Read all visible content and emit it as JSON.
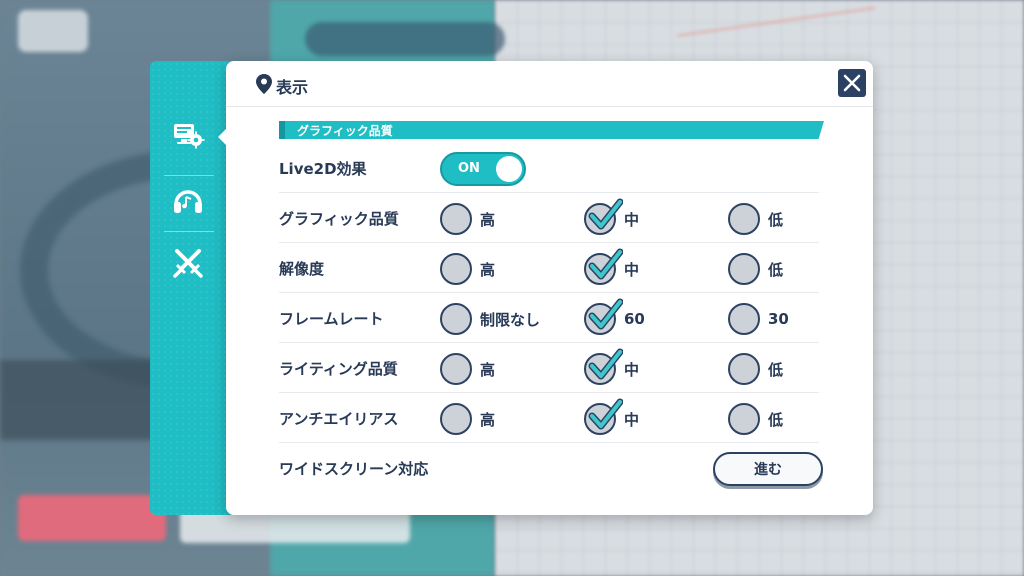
{
  "header": {
    "title": "表示"
  },
  "sidebar": {
    "items": [
      {
        "icon": "display-settings-icon",
        "active": true
      },
      {
        "icon": "headphones-icon",
        "active": false
      },
      {
        "icon": "crossed-swords-icon",
        "active": false
      }
    ]
  },
  "section": {
    "title": "グラフィック品質"
  },
  "live2d": {
    "label": "Live2D効果",
    "toggle_text": "ON",
    "state": true
  },
  "rows": [
    {
      "label": "グラフィック品質",
      "options": [
        "高",
        "中",
        "低"
      ],
      "selected": 1
    },
    {
      "label": "解像度",
      "options": [
        "高",
        "中",
        "低"
      ],
      "selected": 1
    },
    {
      "label": "フレームレート",
      "options": [
        "制限なし",
        "60",
        "30"
      ],
      "selected": 1
    },
    {
      "label": "ライティング品質",
      "options": [
        "高",
        "中",
        "低"
      ],
      "selected": 1
    },
    {
      "label": "アンチエイリアス",
      "options": [
        "高",
        "中",
        "低"
      ],
      "selected": 1
    }
  ],
  "widescreen": {
    "label": "ワイドスクリーン対応",
    "button": "進む"
  },
  "colors": {
    "accent": "#1fbdc4",
    "navy": "#283a56",
    "check": "#3fc8cc"
  }
}
